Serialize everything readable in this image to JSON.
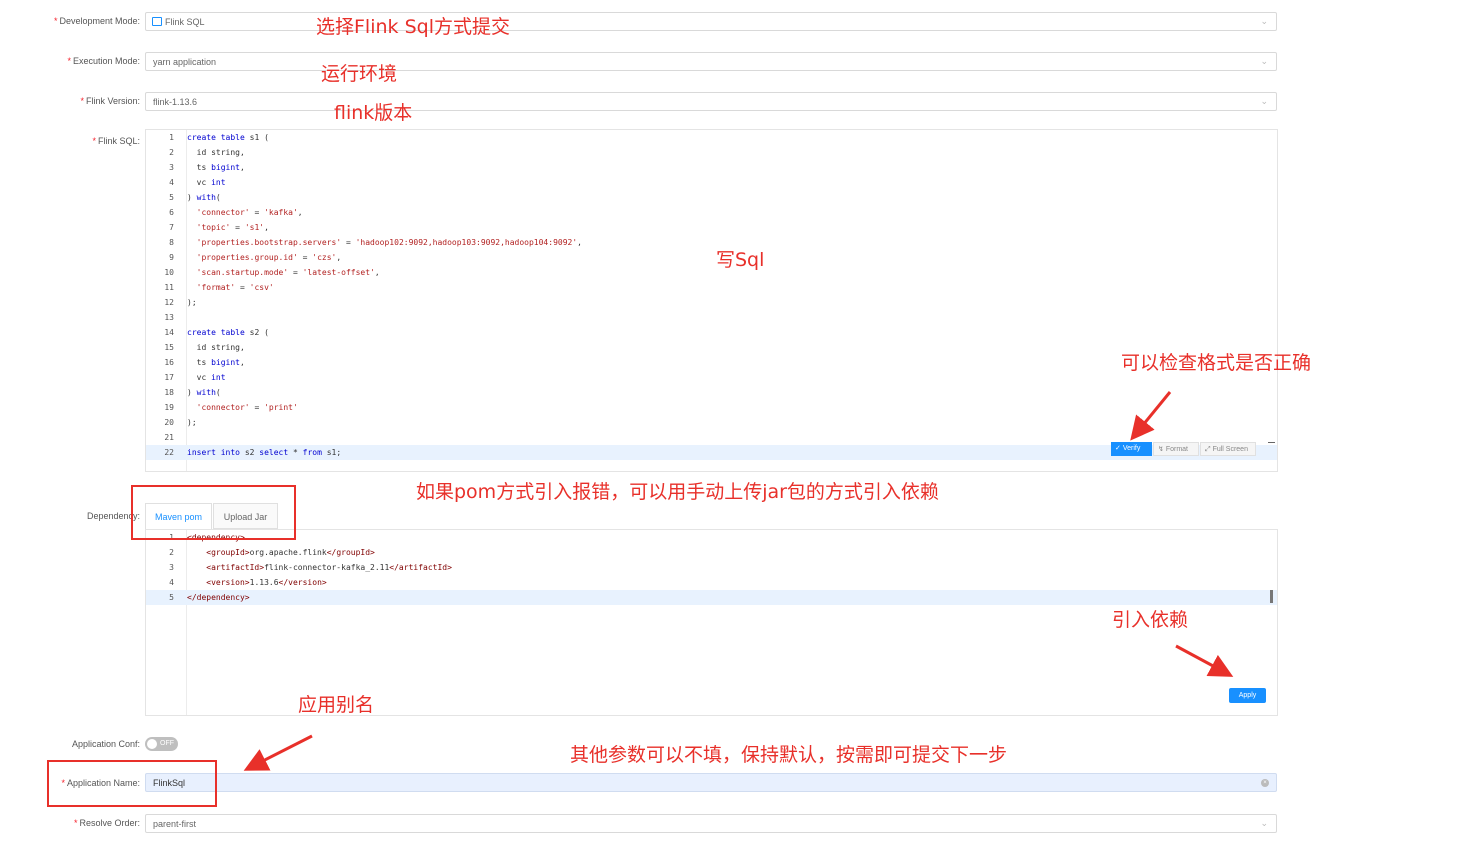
{
  "form": {
    "development_mode": {
      "label": "Development Mode:",
      "value": "Flink SQL"
    },
    "execution_mode": {
      "label": "Execution Mode:",
      "value": "yarn application"
    },
    "flink_version": {
      "label": "Flink Version:",
      "value": "flink-1.13.6"
    },
    "flink_sql": {
      "label": "Flink SQL:"
    },
    "dependency": {
      "label": "Dependency:"
    },
    "application_conf": {
      "label": "Application Conf:",
      "toggle": "OFF"
    },
    "application_name": {
      "label": "Application Name:",
      "value": "FlinkSql"
    },
    "resolve_order": {
      "label": "Resolve Order:",
      "value": "parent-first"
    }
  },
  "sql_editor": {
    "lines": [
      {
        "n": "1",
        "t": "create table s1 ("
      },
      {
        "n": "2",
        "t": "  id string,"
      },
      {
        "n": "3",
        "t": "  ts bigint,"
      },
      {
        "n": "4",
        "t": "  vc int"
      },
      {
        "n": "5",
        "t": ") with("
      },
      {
        "n": "6",
        "t": "  'connector' = 'kafka',"
      },
      {
        "n": "7",
        "t": "  'topic' = 's1',"
      },
      {
        "n": "8",
        "t": "  'properties.bootstrap.servers' = 'hadoop102:9092,hadoop103:9092,hadoop104:9092',"
      },
      {
        "n": "9",
        "t": "  'properties.group.id' = 'czs',"
      },
      {
        "n": "10",
        "t": "  'scan.startup.mode' = 'latest-offset',"
      },
      {
        "n": "11",
        "t": "  'format' = 'csv'"
      },
      {
        "n": "12",
        "t": ");"
      },
      {
        "n": "13",
        "t": ""
      },
      {
        "n": "14",
        "t": "create table s2 ("
      },
      {
        "n": "15",
        "t": "  id string,"
      },
      {
        "n": "16",
        "t": "  ts bigint,"
      },
      {
        "n": "17",
        "t": "  vc int"
      },
      {
        "n": "18",
        "t": ") with("
      },
      {
        "n": "19",
        "t": "  'connector' = 'print'"
      },
      {
        "n": "20",
        "t": ");"
      },
      {
        "n": "21",
        "t": ""
      },
      {
        "n": "22",
        "t": "insert into s2 select * from s1;"
      }
    ],
    "toolbar": {
      "verify": "Verify",
      "format": "Format",
      "full_screen": "Full Screen"
    }
  },
  "dependency_tabs": {
    "maven_pom": "Maven pom",
    "upload_jar": "Upload Jar"
  },
  "pom_editor": {
    "lines": [
      {
        "n": "1",
        "t": "<dependency>"
      },
      {
        "n": "2",
        "t": "    <groupId>org.apache.flink</groupId>"
      },
      {
        "n": "3",
        "t": "    <artifactId>flink-connector-kafka_2.11</artifactId>"
      },
      {
        "n": "4",
        "t": "    <version>1.13.6</version>"
      },
      {
        "n": "5",
        "t": "</dependency>"
      }
    ],
    "apply_label": "Apply"
  },
  "annotations": {
    "dev_mode": "选择Flink Sql方式提交",
    "exec_env": "运行环境",
    "flink_ver": "flink版本",
    "write_sql": "写Sql",
    "check_format": "可以检查格式是否正确",
    "pom_error": "如果pom方式引入报错，可以用手动上传jar包的方式引入依赖",
    "add_dep": "引入依赖",
    "app_alias": "应用别名",
    "others": "其他参数可以不填，保持默认，按需即可提交下一步"
  },
  "colors": {
    "primary": "#1890ff",
    "annotation": "#e8302a",
    "active_line": "#e8f2fe"
  }
}
